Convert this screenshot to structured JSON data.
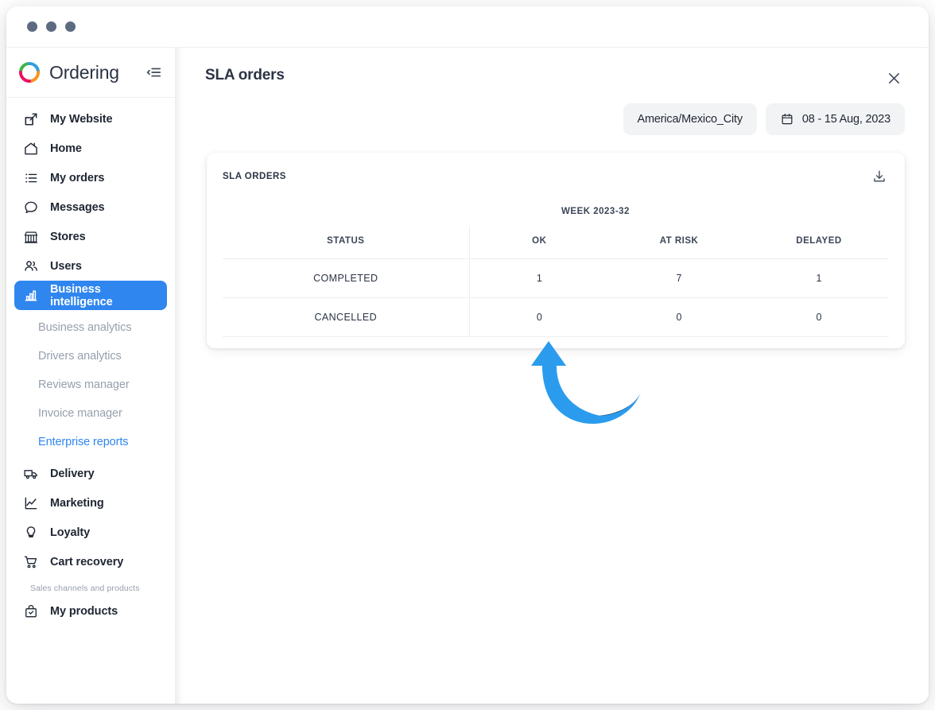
{
  "window": {
    "dots": [
      "window-dot-1",
      "window-dot-2",
      "window-dot-3"
    ]
  },
  "brand": {
    "name": "Ordering",
    "logo_icon": "ordering-logo-icon",
    "logo_colors": {
      "green": "#3cb54a",
      "blue": "#2f9fe0",
      "orange": "#f7941e",
      "pink": "#ec1164"
    },
    "collapse_icon": "collapse-sidebar-icon"
  },
  "sidebar": {
    "items": [
      {
        "label": "My Website",
        "icon": "external-link-icon",
        "active": false
      },
      {
        "label": "Home",
        "icon": "home-icon",
        "active": false
      },
      {
        "label": "My orders",
        "icon": "list-icon",
        "active": false
      },
      {
        "label": "Messages",
        "icon": "chat-bubble-icon",
        "active": false
      },
      {
        "label": "Stores",
        "icon": "store-icon",
        "active": false
      },
      {
        "label": "Users",
        "icon": "users-icon",
        "active": false
      },
      {
        "label": "Business intelligence",
        "icon": "bar-chart-icon",
        "active": true
      }
    ],
    "subitems": [
      {
        "label": "Business analytics",
        "active": false
      },
      {
        "label": "Drivers analytics",
        "active": false
      },
      {
        "label": "Reviews manager",
        "active": false
      },
      {
        "label": "Invoice manager",
        "active": false
      },
      {
        "label": "Enterprise reports",
        "active": true
      }
    ],
    "items_after": [
      {
        "label": "Delivery",
        "icon": "truck-icon",
        "active": false
      },
      {
        "label": "Marketing",
        "icon": "trend-line-icon",
        "active": false
      },
      {
        "label": "Loyalty",
        "icon": "lightbulb-icon",
        "active": false
      },
      {
        "label": "Cart recovery",
        "icon": "shopping-cart-icon",
        "active": false
      }
    ],
    "section_label": "Sales channels and products",
    "items_last": [
      {
        "label": "My products",
        "icon": "product-bag-icon",
        "active": false
      }
    ],
    "active_color": "#3086ef"
  },
  "header": {
    "title": "SLA orders",
    "close_icon": "close-icon"
  },
  "filters": {
    "timezone": {
      "label": "America/Mexico_City",
      "icon": null
    },
    "date_range": {
      "label": "08 - 15 Aug, 2023",
      "icon": "calendar-icon"
    }
  },
  "card": {
    "title": "SLA ORDERS",
    "download_icon": "download-icon"
  },
  "chart_data": {
    "type": "table",
    "title": "SLA ORDERS",
    "group_header": "WEEK 2023-32",
    "columns": [
      "STATUS",
      "OK",
      "AT RISK",
      "DELAYED"
    ],
    "rows": [
      {
        "status": "COMPLETED",
        "ok": "1",
        "at_risk": "7",
        "delayed": "1"
      },
      {
        "status": "CANCELLED",
        "ok": "0",
        "at_risk": "0",
        "delayed": "0"
      }
    ]
  },
  "annotation": {
    "icon": "curved-up-arrow-annotation",
    "arrow_color": "#2b9ced",
    "shadow_color": "#133f66"
  }
}
